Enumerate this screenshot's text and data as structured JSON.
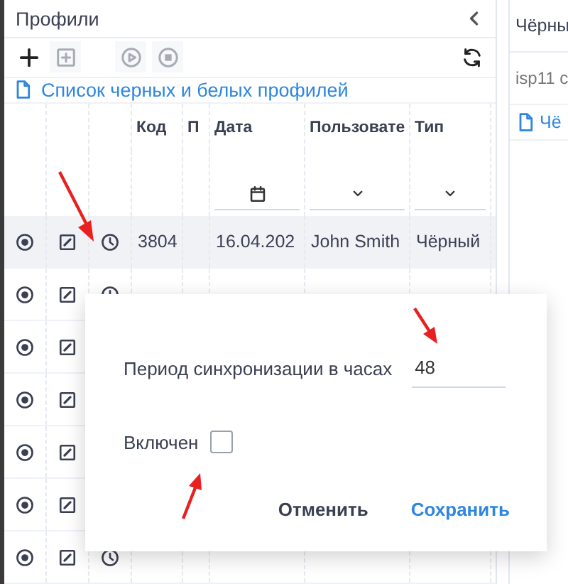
{
  "left_panel": {
    "title": "Профили",
    "link": "Список черных и белых профилей"
  },
  "toolbar": [
    {
      "kind": "plus",
      "disabled": false
    },
    {
      "kind": "add-box",
      "disabled": true
    },
    {
      "kind": "play",
      "disabled": true
    },
    {
      "kind": "stop",
      "disabled": true
    },
    {
      "kind": "refresh",
      "disabled": false
    }
  ],
  "table": {
    "columns": [
      {
        "label": "Код"
      },
      {
        "label": "П"
      },
      {
        "label": "Дата",
        "kind": "date"
      },
      {
        "label": "Пользовате",
        "kind": "select"
      },
      {
        "label": "Тип",
        "kind": "select"
      }
    ],
    "rows": [
      {
        "selected": true,
        "cells": [
          "3804",
          "16.04.202",
          "John Smith",
          "Чёрный"
        ]
      },
      {
        "selected": false
      },
      {
        "selected": false
      },
      {
        "selected": false
      },
      {
        "selected": false
      },
      {
        "selected": false
      },
      {
        "selected": false
      }
    ]
  },
  "dialog": {
    "field_label": "Период синхронизации в часах",
    "field_value": "48",
    "checkbox_label": "Включен",
    "checked": false,
    "buttons": [
      {
        "label": "Отменить",
        "kind": "secondary"
      },
      {
        "label": "Сохранить",
        "kind": "primary"
      }
    ]
  },
  "right_panel": {
    "title": "Чёрны",
    "subtitle": "isp11 с",
    "link": "Чё"
  }
}
